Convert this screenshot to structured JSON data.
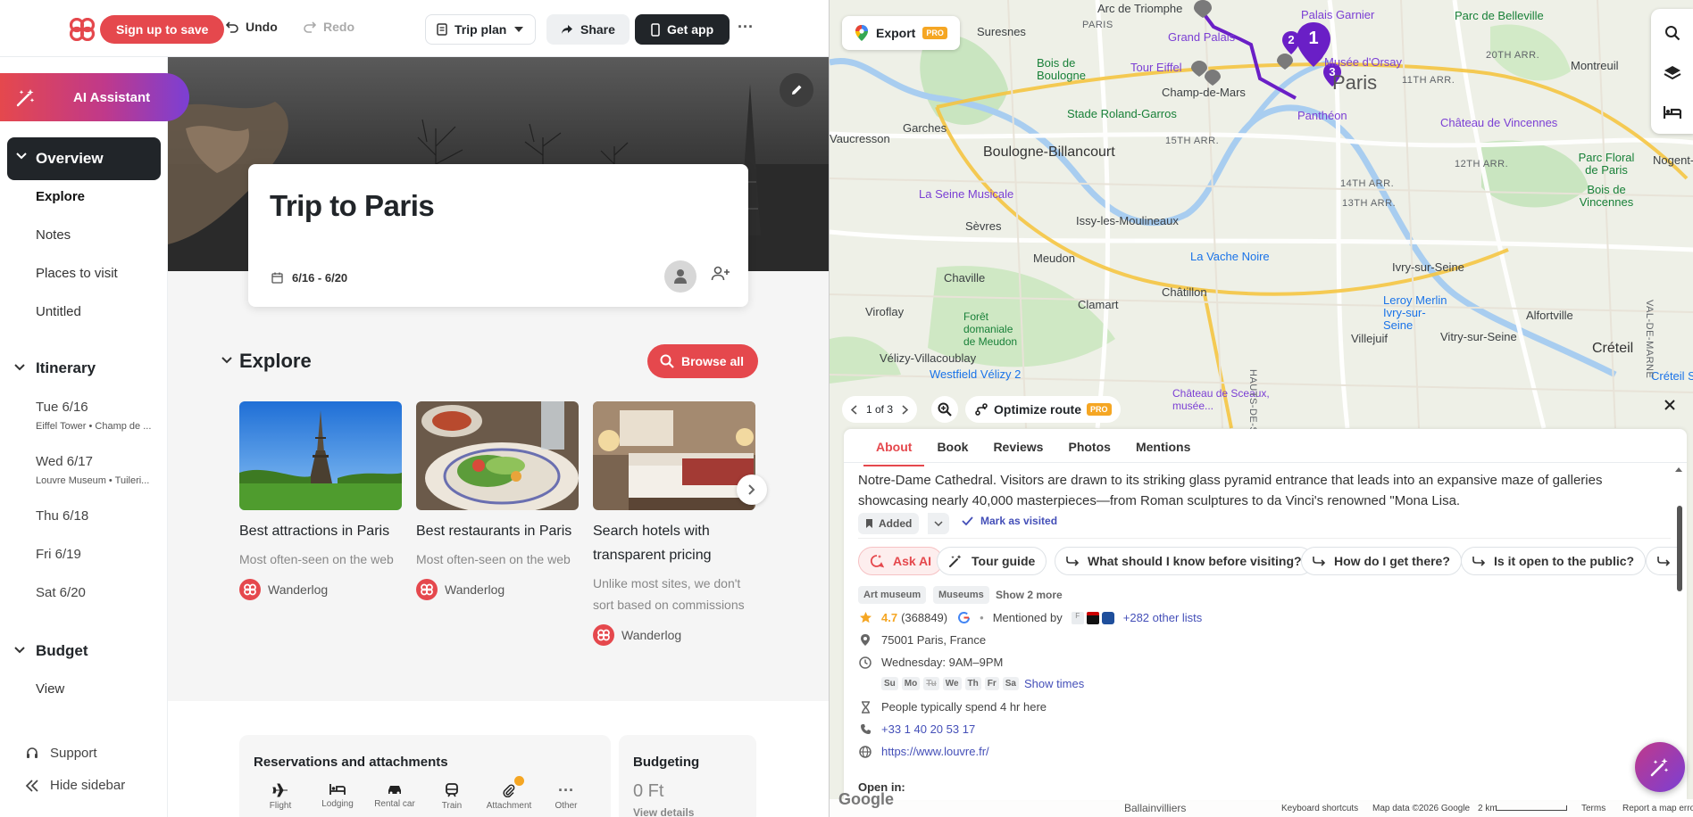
{
  "topbar": {
    "signup": "Sign up to save",
    "undo": "Undo",
    "redo": "Redo",
    "trip_plan": "Trip plan",
    "share": "Share",
    "get_app": "Get app",
    "more": "···"
  },
  "sidebar": {
    "ai_assistant": "AI Assistant",
    "overview": "Overview",
    "overview_items": [
      "Explore",
      "Notes",
      "Places to visit",
      "Untitled"
    ],
    "itinerary": "Itinerary",
    "days": [
      {
        "label": "Tue 6/16",
        "sub": "Eiffel Tower • Champ de ..."
      },
      {
        "label": "Wed 6/17",
        "sub": "Louvre Museum • Tuileri..."
      },
      {
        "label": "Thu 6/18",
        "sub": ""
      },
      {
        "label": "Fri 6/19",
        "sub": ""
      },
      {
        "label": "Sat 6/20",
        "sub": ""
      }
    ],
    "budget": "Budget",
    "budget_view": "View",
    "support": "Support",
    "hide_sidebar": "Hide sidebar"
  },
  "main": {
    "trip_title": "Trip to Paris",
    "trip_dates": "6/16 - 6/20",
    "explore_heading": "Explore",
    "browse_all": "Browse all",
    "cards": [
      {
        "title": "Best attractions in Paris",
        "desc": "Most often-seen on the web",
        "source": "Wanderlog"
      },
      {
        "title": "Best restaurants in Paris",
        "desc": "Most often-seen on the web",
        "source": "Wanderlog"
      },
      {
        "title": "Search hotels with transparent pricing",
        "desc": "Unlike most sites, we don't sort based on commissions",
        "source": "Wanderlog"
      }
    ],
    "reservations_title": "Reservations and attachments",
    "reservation_types": [
      "Flight",
      "Lodging",
      "Rental car",
      "Train",
      "Attachment",
      "Other"
    ],
    "budgeting_title": "Budgeting",
    "budget_value": "0 Ft",
    "view_details": "View details"
  },
  "map": {
    "export": "Export",
    "pro": "PRO",
    "pager": "1 of 3",
    "optimize_route": "Optimize route",
    "labels": {
      "arc": "Arc de Triomphe",
      "palais_garnier": "Palais Garnier",
      "parc_belleville": "Parc de Belleville",
      "suresnes": "Suresnes",
      "paris_lbl": "PARIS",
      "grand_palais": "Grand Palais",
      "musee_orsay": "Musée d'Orsay",
      "paris_big": "Paris",
      "twentieth": "20TH ARR.",
      "montreuil": "Montreuil",
      "bois_boulogne": "Bois de Boulogne",
      "tour_eiffel": "Tour Eiffel",
      "champ_mars": "Champ-de-Mars",
      "eleventh": "11TH ARR.",
      "stade": "Stade Roland-Garros",
      "pantheon": "Panthéon",
      "chateau_vincennes": "Château de Vincennes",
      "garches": "Garches",
      "vaucresson": "Vaucresson",
      "fifteenth": "15TH ARR.",
      "boulogne": "Boulogne-Billancourt",
      "twelfth": "12TH ARR.",
      "parc_floral": "Parc Floral de Paris",
      "nogent": "Nogent-s",
      "fourteenth": "14TH ARR.",
      "thirteenth": "13TH ARR.",
      "seine_musicale": "La Seine Musicale",
      "bois_vincennes": "Bois de Vincennes",
      "sevres": "Sèvres",
      "issy": "Issy-les-Moulineaux",
      "chaville": "Chaville",
      "meudon": "Meudon",
      "vache_noire": "La Vache Noire",
      "ivry": "Ivry-sur-Seine",
      "clamart": "Clamart",
      "chatillon": "Châtillon",
      "leroy": "Leroy Merlin Ivry-sur-Seine",
      "alfortville": "Alfortville",
      "viroflay": "Viroflay",
      "foret": "Forêt domaniale de Meudon",
      "villejuif": "Villejuif",
      "vitry": "Vitry-sur-Seine",
      "velizy": "Vélizy-Villacoublay",
      "creteil": "Créteil",
      "westfield": "Westfield Vélizy 2",
      "creteil_soleil": "Créteil Sol",
      "chateau_sceaux": "Château de Sceaux, musée...",
      "hauts_seine": "HAUTS-DE-SEINE",
      "val_marne": "VAL-DE-MARNE",
      "ballainvilliers": "Ballainvilliers"
    },
    "pins": [
      "1",
      "2",
      "3"
    ]
  },
  "panel": {
    "tabs": [
      "About",
      "Book",
      "Reviews",
      "Photos",
      "Mentions"
    ],
    "active_tab": "About",
    "description": "Notre-Dame Cathedral. Visitors are drawn to its striking glass pyramid entrance that leads into an expansive maze of galleries showcasing nearly 40,000 masterpieces—from Roman sculptures to da Vinci's renowned \"Mona Lisa.",
    "added": "Added",
    "mark_visited": "Mark as visited",
    "chips": [
      "Ask AI",
      "Tour guide",
      "What should I know before visiting?",
      "How do I get there?",
      "Is it open to the public?"
    ],
    "tags": [
      "Art museum",
      "Museums"
    ],
    "tags_more": "Show 2 more",
    "rating": "4.7",
    "reviews_count": "(368849)",
    "mentioned_by": "Mentioned by",
    "other_lists": "+282 other lists",
    "address": "75001 Paris, France",
    "hours": "Wednesday: 9AM–9PM",
    "weekdays": [
      "Su",
      "Mo",
      "Tu",
      "We",
      "Th",
      "Fr",
      "Sa"
    ],
    "show_times": "Show times",
    "duration": "People typically spend 4 hr here",
    "phone": "+33 1 40 20 53 17",
    "website": "https://www.louvre.fr/",
    "open_in": "Open in:"
  },
  "map_footer": {
    "google": "Google",
    "shortcuts": "Keyboard shortcuts",
    "map_data": "Map data ©2026 Google",
    "scale": "2 km",
    "terms": "Terms",
    "report": "Report a map erro"
  },
  "colors": {
    "accent": "#e5484d",
    "route": "#7b3fd4",
    "link": "#444fb8",
    "dark": "#212529"
  }
}
